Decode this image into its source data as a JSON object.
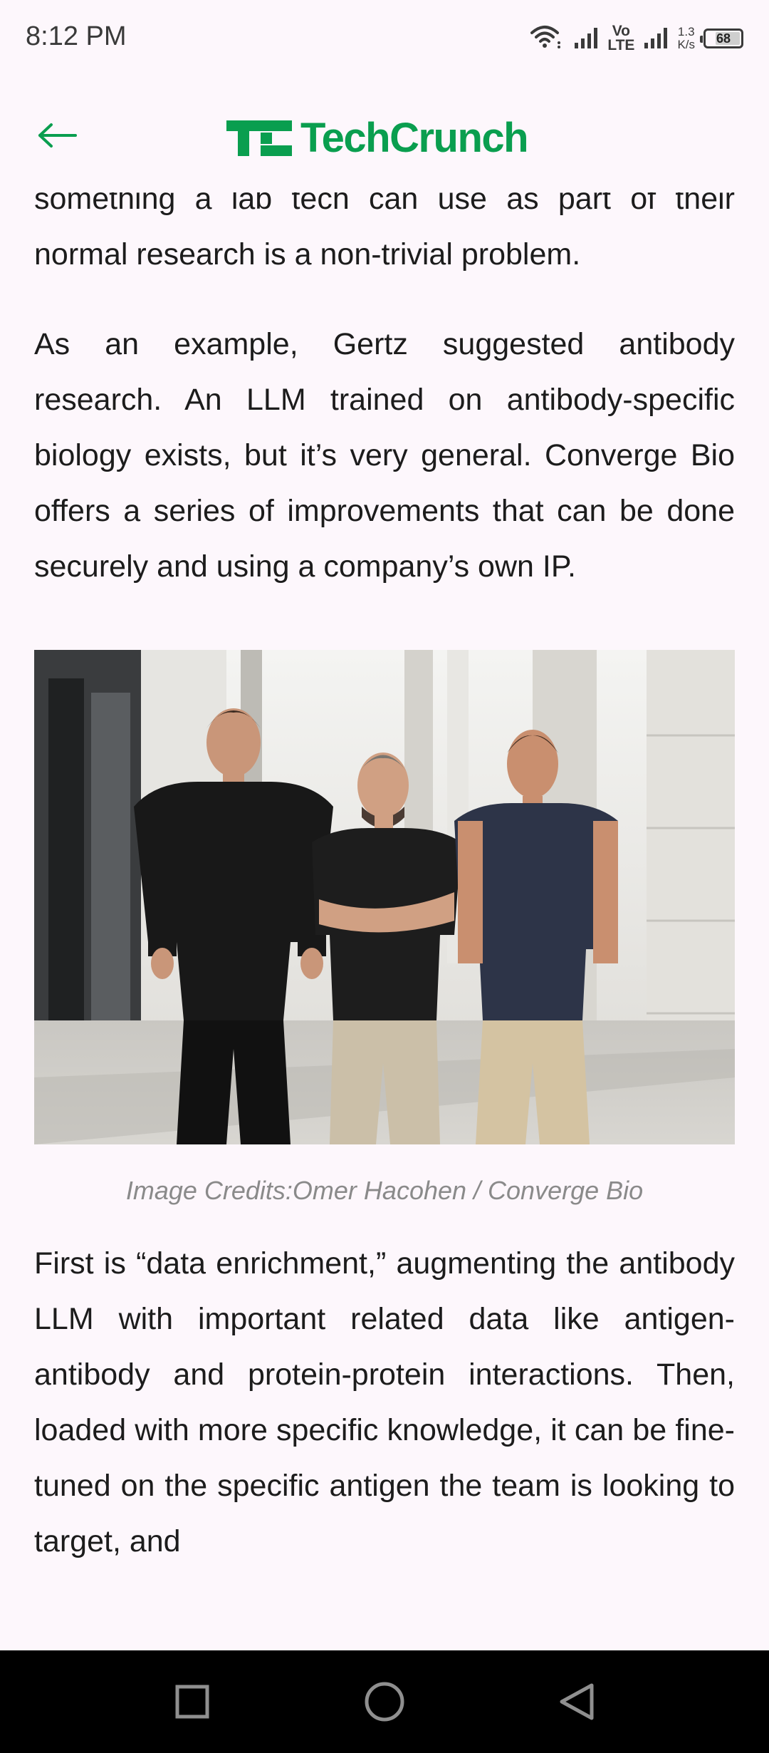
{
  "status_bar": {
    "time": "8:12 PM",
    "network_type": "Vo\nLTE",
    "speed_value": "1.3",
    "speed_unit": "K/s",
    "battery": "68",
    "battery_fraction": 0.68
  },
  "header": {
    "back_icon": "arrow-left-icon",
    "logo_text": "TechCrunch",
    "brand_color": "#0a9e4f"
  },
  "article": {
    "paragraph_top_partial": "something a lab tech can use as part of their normal research is a non-trivial problem.",
    "paragraph_2": "As an example, Gertz suggested antibody research. An LLM trained on antibody-specific biology exists, but it’s very general. Converge Bio offers a series of improvements that can be done securely and using a company’s own IP.",
    "image_caption": "Image Credits:Omer Hacohen / Converge Bio",
    "paragraph_3": "First is “data enrichment,” augmenting the antibody LLM with important related data like antigen-antibody and protein-protein interactions. Then, loaded with more specific knowledge, it can be fine-tuned on the specific antigen the team is looking to target, and"
  },
  "nav_bar": {
    "recents_icon": "square-icon",
    "home_icon": "circle-icon",
    "back_icon": "triangle-back-icon"
  }
}
